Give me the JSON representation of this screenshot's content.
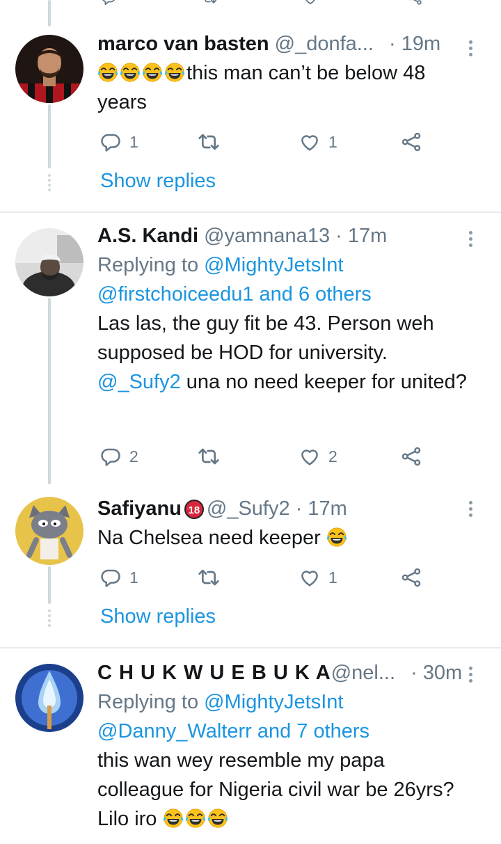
{
  "colors": {
    "link": "#1b95e0",
    "secondary": "#657786",
    "divider": "#e6ecf0",
    "thread": "#cfd9de"
  },
  "tweets": [
    {
      "name": "marco van basten",
      "handle": "@_donfa...",
      "time": "· 19m",
      "avatar_icon": "footballer-avatar",
      "text_before_emoji": "",
      "emoji_count": 4,
      "text_after_emoji": "this man can’t be below 48 years",
      "actions": {
        "reply_count": "1",
        "retweet_count": "",
        "like_count": "1"
      },
      "show_replies": "Show replies"
    },
    {
      "name": "A.S. Kandi",
      "handle": "@yamnana13",
      "time": "· 17m",
      "avatar_icon": "man-portrait-avatar",
      "replying_to_prefix": "Replying to ",
      "replying_to_user": "@MightyJetsInt",
      "replying_to_rest": "@firstchoiceedu1 and 6 others",
      "text_line": "Las las, the guy fit be 43. Person weh supposed be HOD for university.",
      "mention": "@_Sufy2",
      "text_after_mention": " una no need keeper for united?",
      "actions": {
        "reply_count": "2",
        "retweet_count": "",
        "like_count": "2"
      }
    },
    {
      "name": "Safiyanu",
      "badge": "18",
      "handle": "@_Sufy2",
      "time": "· 17m",
      "avatar_icon": "cartoon-cat-avatar",
      "text": "Na Chelsea need keeper",
      "emoji_count": 1,
      "actions": {
        "reply_count": "1",
        "retweet_count": "",
        "like_count": "1"
      },
      "show_replies": "Show replies"
    },
    {
      "name": "C H U K W U E B U K A",
      "handle": "@nel...",
      "time": "· 30m",
      "avatar_icon": "water-splash-avatar",
      "replying_to_prefix": "Replying to ",
      "replying_to_user": "@MightyJetsInt",
      "replying_to_rest": "@Danny_Walterr and 7 others",
      "text": "this wan wey resemble my papa colleague for Nigeria civil war be 26yrs?  Lilo iro",
      "emoji_count": 3
    }
  ]
}
